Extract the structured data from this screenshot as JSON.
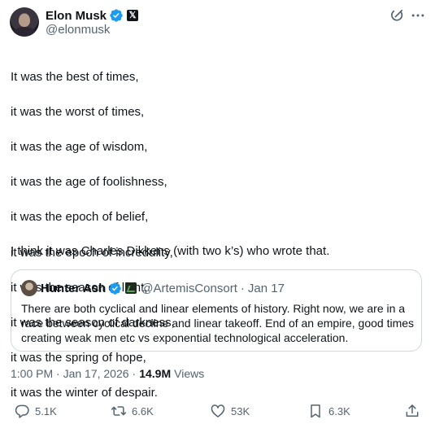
{
  "author": {
    "name": "Elon Musk",
    "handle": "@elonmusk"
  },
  "tweet": {
    "lines": [
      "It was the best of times,",
      "it was the worst of times,",
      "it was the age of wisdom,",
      "it was the age of foolishness,",
      "it was the epoch of belief,",
      "it was the epoch of incredulity,",
      "it was the season of light,",
      "it was the season of darkness,",
      "it was the spring of hope,",
      "it was the winter of despair."
    ],
    "closing": "I think it was Charles Dikkens (with two k’s) who wrote that."
  },
  "quote": {
    "name": "Hunter Ash",
    "handle": "@ArtemisConsort",
    "separator": "·",
    "date": "Jan 17",
    "text": "There are both cyclical and linear elements of history. Right now, we are in a race between cyclical decline and linear takeoff. End of an empire, good times creating weak men etc vs exponential technological acceleration."
  },
  "meta": {
    "time": "1:00 PM · Jan 17, 2026",
    "dot": "·",
    "views_count": "14.9M",
    "views_label": "Views"
  },
  "actions": {
    "replies": "5.1K",
    "reposts": "6.6K",
    "likes": "53K",
    "bookmarks": "6.3K"
  },
  "icons": {
    "verified": "verified-badge-icon",
    "grok": "grok-icon",
    "more": "more-icon",
    "reply": "reply-icon",
    "repost": "repost-icon",
    "like": "heart-icon",
    "bookmark": "bookmark-icon",
    "share": "share-icon"
  },
  "colors": {
    "verified_blue": "#1d9bf0",
    "text": "#0f1419",
    "secondary": "#536471",
    "border": "#cfd9de"
  }
}
